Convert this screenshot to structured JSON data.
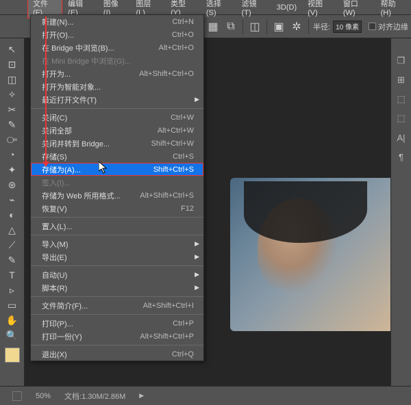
{
  "menubar": [
    {
      "label": "文件(F)",
      "active": true
    },
    {
      "label": "编辑(E)"
    },
    {
      "label": "图像(I)"
    },
    {
      "label": "图层(L)"
    },
    {
      "label": "类型(Y)"
    },
    {
      "label": "选择(S)"
    },
    {
      "label": "滤镜(T)"
    },
    {
      "label": "3D(D)"
    },
    {
      "label": "视图(V)"
    },
    {
      "label": "窗口(W)"
    },
    {
      "label": "帮助(H)"
    }
  ],
  "topbar": {
    "radius_label": "半径:",
    "radius_value": "10 像素",
    "align_label": "对齐边缘"
  },
  "dropdown": [
    {
      "label": "新建(N)...",
      "shortcut": "Ctrl+N"
    },
    {
      "label": "打开(O)...",
      "shortcut": "Ctrl+O"
    },
    {
      "label": "在 Bridge 中浏览(B)...",
      "shortcut": "Alt+Ctrl+O"
    },
    {
      "label": "在 Mini Bridge 中浏览(G)...",
      "disabled": true
    },
    {
      "label": "打开为...",
      "shortcut": "Alt+Shift+Ctrl+O"
    },
    {
      "label": "打开为智能对象..."
    },
    {
      "label": "最近打开文件(T)",
      "submenu": true
    },
    {
      "sep": true
    },
    {
      "label": "关闭(C)",
      "shortcut": "Ctrl+W"
    },
    {
      "label": "关闭全部",
      "shortcut": "Alt+Ctrl+W"
    },
    {
      "label": "关闭并转到 Bridge...",
      "shortcut": "Shift+Ctrl+W"
    },
    {
      "label": "存储(S)",
      "shortcut": "Ctrl+S"
    },
    {
      "label": "存储为(A)...",
      "shortcut": "Shift+Ctrl+S",
      "highlight": true,
      "boxed": true
    },
    {
      "label": "签入(I)...",
      "disabled": true
    },
    {
      "label": "存储为 Web 所用格式...",
      "shortcut": "Alt+Shift+Ctrl+S"
    },
    {
      "label": "恢复(V)",
      "shortcut": "F12"
    },
    {
      "sep": true
    },
    {
      "label": "置入(L)..."
    },
    {
      "sep": true
    },
    {
      "label": "导入(M)",
      "submenu": true
    },
    {
      "label": "导出(E)",
      "submenu": true
    },
    {
      "sep": true
    },
    {
      "label": "自动(U)",
      "submenu": true
    },
    {
      "label": "脚本(R)",
      "submenu": true
    },
    {
      "sep": true
    },
    {
      "label": "文件简介(F)...",
      "shortcut": "Alt+Shift+Ctrl+I"
    },
    {
      "sep": true
    },
    {
      "label": "打印(P)...",
      "shortcut": "Ctrl+P"
    },
    {
      "label": "打印一份(Y)",
      "shortcut": "Alt+Shift+Ctrl+P"
    },
    {
      "sep": true
    },
    {
      "label": "退出(X)",
      "shortcut": "Ctrl+Q"
    }
  ],
  "statusbar": {
    "zoom": "50%",
    "doc_info": "文档:1.30M/2.86M"
  },
  "tools_left": [
    "↖",
    "⊡",
    "◫",
    "✧",
    "✂",
    "✎",
    "⧃",
    "◔",
    "✦",
    "⊛",
    "⌁",
    "◐",
    "△",
    "⟋",
    "✎",
    "T",
    "▹",
    "▭",
    "✋",
    "🔍"
  ],
  "panels_right": [
    "❐",
    "⊞",
    "⬚",
    "⬚",
    "A|",
    "¶"
  ]
}
